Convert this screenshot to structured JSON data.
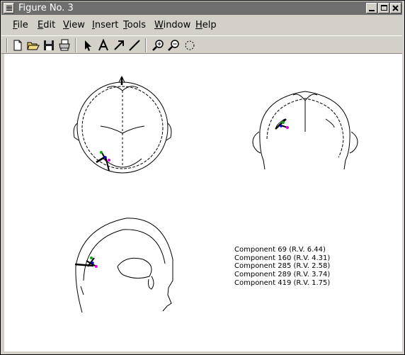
{
  "window": {
    "title": "Figure No. 3"
  },
  "menus": [
    {
      "pre": "",
      "u": "F",
      "post": "ile"
    },
    {
      "pre": "",
      "u": "E",
      "post": "dit"
    },
    {
      "pre": "",
      "u": "V",
      "post": "iew"
    },
    {
      "pre": "",
      "u": "I",
      "post": "nsert"
    },
    {
      "pre": "",
      "u": "T",
      "post": "ools"
    },
    {
      "pre": "",
      "u": "W",
      "post": "indow"
    },
    {
      "pre": "",
      "u": "H",
      "post": "elp"
    }
  ],
  "toolbar": {
    "icons": [
      "new-file-icon",
      "open-folder-icon",
      "save-icon",
      "print-icon",
      "pointer-icon",
      "text-tool-icon",
      "arrow-tool-icon",
      "line-tool-icon",
      "zoom-in-icon",
      "zoom-out-icon",
      "rotate-icon"
    ]
  },
  "legend": [
    "Component 69 (R.V. 6.44)",
    "Component 160 (R.V. 4.31)",
    "Component 285 (R.V. 2.58)",
    "Component 289 (R.V. 3.74)",
    "Component 419 (R.V. 1.75)"
  ],
  "colors": {
    "dipole_green": "#00b000",
    "dipole_magenta": "#e000e0",
    "dipole_blue": "#0000e0",
    "titlebar": "#6e6e6e",
    "chrome": "#d4d0c8"
  }
}
